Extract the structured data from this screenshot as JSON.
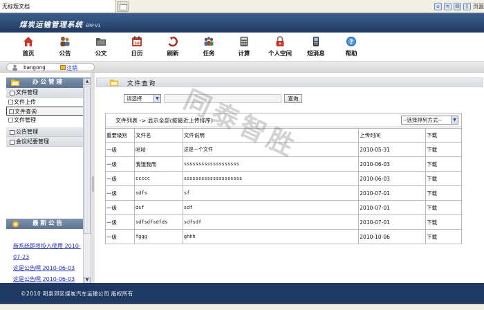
{
  "browser": {
    "tab_title": "无标题文档",
    "page_menu": "页面"
  },
  "app": {
    "title": "煤炭运输管理系统",
    "subtitle": "ERP-V1"
  },
  "toolbar": [
    {
      "label": "首页",
      "icon": "home-icon",
      "color": "#c0392b"
    },
    {
      "label": "公告",
      "icon": "people-icon",
      "color": "#6b4a2a"
    },
    {
      "label": "公文",
      "icon": "folder-icon",
      "color": "#4d4d4d"
    },
    {
      "label": "日历",
      "icon": "calendar-icon",
      "color": "#c0392b"
    },
    {
      "label": "刷新",
      "icon": "refresh-icon",
      "color": "#a83224"
    },
    {
      "label": "任务",
      "icon": "group-icon",
      "color": "#4a4a4a"
    },
    {
      "label": "计算",
      "icon": "calculator-icon",
      "color": "#555555"
    },
    {
      "label": "个人空间",
      "icon": "lock-icon",
      "color": "#c0392b"
    },
    {
      "label": "短消息",
      "icon": "phone-icon",
      "color": "#333333"
    },
    {
      "label": "帮助",
      "icon": "help-icon",
      "color": "#2d6fc2"
    }
  ],
  "user": {
    "name": "bangong",
    "logout": "注销"
  },
  "sidebar": {
    "title": "办公管理",
    "groups": [
      {
        "label": "文件管理",
        "items": [
          "文件上传",
          "文件查询",
          "文件管理"
        ]
      },
      {
        "label": "公告管理",
        "items": []
      },
      {
        "label": "会议纪要管理",
        "items": []
      }
    ],
    "selected": "文件查询"
  },
  "notice_box": {
    "title": "最新公告",
    "items": [
      "新系统即将投入使用 2010-07-23",
      "这是公告啊 2010-06-03",
      "这是公告啊 2010-06-03"
    ]
  },
  "main": {
    "title": "文件查询",
    "filter": {
      "type_value": "请选择",
      "keyword": "",
      "search_label": "查询"
    },
    "list_caption": "文件列表 -> 显示全部(按最近上传排序)",
    "sort_value": "--选择排列方式--",
    "columns": [
      "重要级别",
      "文件名",
      "文件说明",
      "上传时间",
      "下载"
    ],
    "rows": [
      {
        "level": "一级",
        "name": "哈哈",
        "desc": "这是一个文件",
        "date": "2010-05-31",
        "download": "下载"
      },
      {
        "level": "一级",
        "name": "我饿我而",
        "desc": "sssssssssssssssssss",
        "date": "2010-06-03",
        "download": "下载"
      },
      {
        "level": "一级",
        "name": "ccccc",
        "desc": "ssssssssssssssssssss",
        "date": "2010-06-03",
        "download": "下载"
      },
      {
        "level": "一级",
        "name": "sdfs",
        "desc": "sf",
        "date": "2010-07-01",
        "download": "下载"
      },
      {
        "level": "一级",
        "name": "dsf",
        "desc": "sdf",
        "date": "2010-07-01",
        "download": "下载"
      },
      {
        "level": "一级",
        "name": "sdfsdfsdfds",
        "desc": "sdfsdf",
        "date": "2010-07-01",
        "download": "下载"
      },
      {
        "level": "一级",
        "name": "fggg",
        "desc": "ghhh",
        "date": "2010-10-06",
        "download": "下载"
      }
    ]
  },
  "watermark": "同泰智胜",
  "footer": {
    "text": "©2010  阳泉郊区煤炭汽车运输公司    版权所有"
  }
}
